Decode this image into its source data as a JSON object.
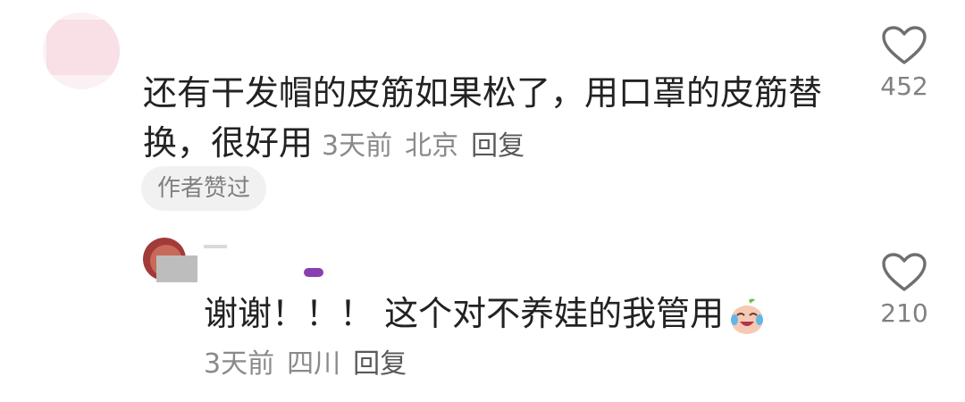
{
  "comment": {
    "text": "还有干发帽的皮筋如果松了，用口罩的皮筋替换，很好用",
    "time": "3天前",
    "location": "北京",
    "reply_label": "回复",
    "author_badge": "作者赞过",
    "like_count": "452"
  },
  "reply": {
    "text": "谢谢！！！ 这个对不养娃的我管用",
    "time": "3天前",
    "location": "四川",
    "reply_label": "回复",
    "like_count": "210"
  },
  "icons": {
    "like": "heart-outline-icon",
    "emoji": "laughing-tears-emoji"
  },
  "colors": {
    "text": "#222222",
    "meta": "#8a8a8a",
    "badge_bg": "#f1f1f1"
  }
}
